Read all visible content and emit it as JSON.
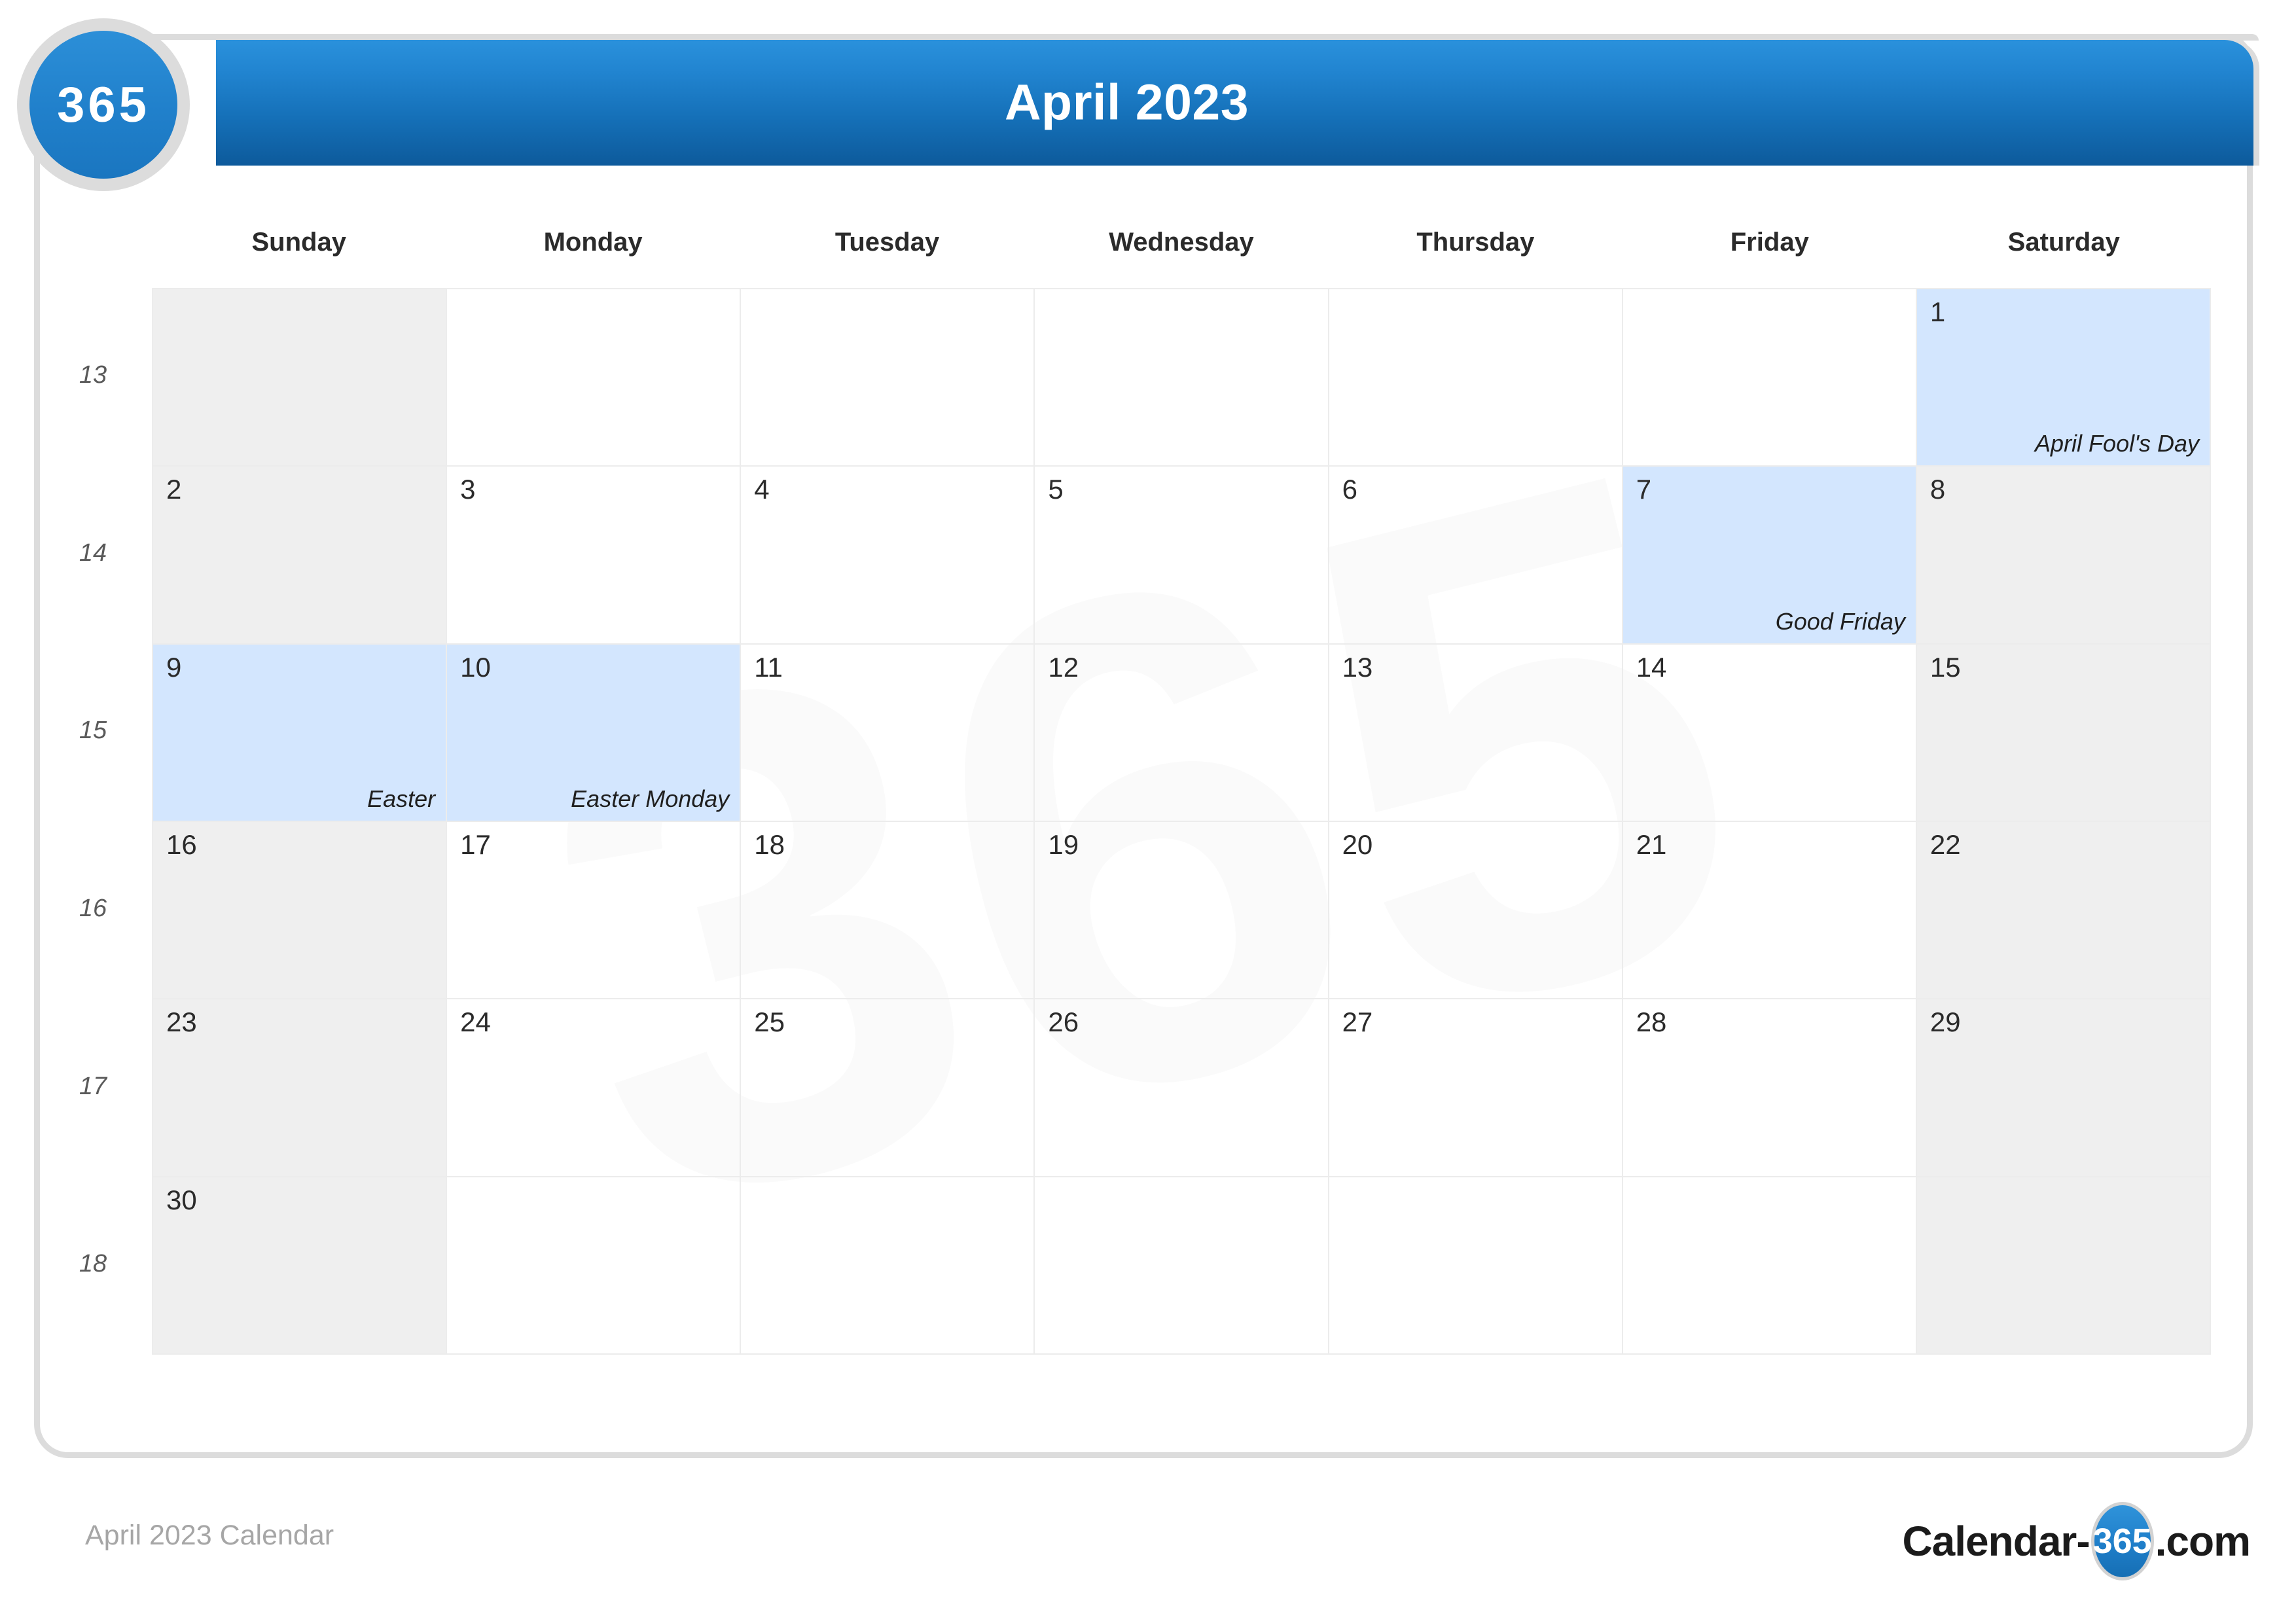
{
  "brand": {
    "badge_text": "365",
    "logo_prefix": "Calendar-",
    "logo_badge": "365",
    "logo_suffix": ".com"
  },
  "header": {
    "title": "April 2023"
  },
  "footer": {
    "caption": "April 2023 Calendar"
  },
  "watermark": {
    "text": "365"
  },
  "colors": {
    "header_gradient_top": "#2a91dc",
    "header_gradient_bottom": "#0d5a9b",
    "holiday_cell": "#d3e6fe",
    "weekend_cell": "#efefef",
    "card_border": "#dcdcdc",
    "grid_line": "#ececec",
    "footer_text": "#a6a6a6",
    "week_number": "#5a5a5a"
  },
  "calendar": {
    "day_headers": [
      "Sunday",
      "Monday",
      "Tuesday",
      "Wednesday",
      "Thursday",
      "Friday",
      "Saturday"
    ],
    "week_numbers": [
      "13",
      "14",
      "15",
      "16",
      "17",
      "18"
    ],
    "weeks": [
      [
        {
          "day": "",
          "holiday": "",
          "style": "weekend"
        },
        {
          "day": "",
          "holiday": "",
          "style": "plain"
        },
        {
          "day": "",
          "holiday": "",
          "style": "plain"
        },
        {
          "day": "",
          "holiday": "",
          "style": "plain"
        },
        {
          "day": "",
          "holiday": "",
          "style": "plain"
        },
        {
          "day": "",
          "holiday": "",
          "style": "plain"
        },
        {
          "day": "1",
          "holiday": "April Fool's Day",
          "style": "holiday"
        }
      ],
      [
        {
          "day": "2",
          "holiday": "",
          "style": "weekend"
        },
        {
          "day": "3",
          "holiday": "",
          "style": "plain"
        },
        {
          "day": "4",
          "holiday": "",
          "style": "plain"
        },
        {
          "day": "5",
          "holiday": "",
          "style": "plain"
        },
        {
          "day": "6",
          "holiday": "",
          "style": "plain"
        },
        {
          "day": "7",
          "holiday": "Good Friday",
          "style": "holiday"
        },
        {
          "day": "8",
          "holiday": "",
          "style": "weekend"
        }
      ],
      [
        {
          "day": "9",
          "holiday": "Easter",
          "style": "holiday"
        },
        {
          "day": "10",
          "holiday": "Easter Monday",
          "style": "holiday"
        },
        {
          "day": "11",
          "holiday": "",
          "style": "plain"
        },
        {
          "day": "12",
          "holiday": "",
          "style": "plain"
        },
        {
          "day": "13",
          "holiday": "",
          "style": "plain"
        },
        {
          "day": "14",
          "holiday": "",
          "style": "plain"
        },
        {
          "day": "15",
          "holiday": "",
          "style": "weekend"
        }
      ],
      [
        {
          "day": "16",
          "holiday": "",
          "style": "weekend"
        },
        {
          "day": "17",
          "holiday": "",
          "style": "plain"
        },
        {
          "day": "18",
          "holiday": "",
          "style": "plain"
        },
        {
          "day": "19",
          "holiday": "",
          "style": "plain"
        },
        {
          "day": "20",
          "holiday": "",
          "style": "plain"
        },
        {
          "day": "21",
          "holiday": "",
          "style": "plain"
        },
        {
          "day": "22",
          "holiday": "",
          "style": "weekend"
        }
      ],
      [
        {
          "day": "23",
          "holiday": "",
          "style": "weekend"
        },
        {
          "day": "24",
          "holiday": "",
          "style": "plain"
        },
        {
          "day": "25",
          "holiday": "",
          "style": "plain"
        },
        {
          "day": "26",
          "holiday": "",
          "style": "plain"
        },
        {
          "day": "27",
          "holiday": "",
          "style": "plain"
        },
        {
          "day": "28",
          "holiday": "",
          "style": "plain"
        },
        {
          "day": "29",
          "holiday": "",
          "style": "weekend"
        }
      ],
      [
        {
          "day": "30",
          "holiday": "",
          "style": "weekend"
        },
        {
          "day": "",
          "holiday": "",
          "style": "plain"
        },
        {
          "day": "",
          "holiday": "",
          "style": "plain"
        },
        {
          "day": "",
          "holiday": "",
          "style": "plain"
        },
        {
          "day": "",
          "holiday": "",
          "style": "plain"
        },
        {
          "day": "",
          "holiday": "",
          "style": "plain"
        },
        {
          "day": "",
          "holiday": "",
          "style": "weekend"
        }
      ]
    ]
  }
}
